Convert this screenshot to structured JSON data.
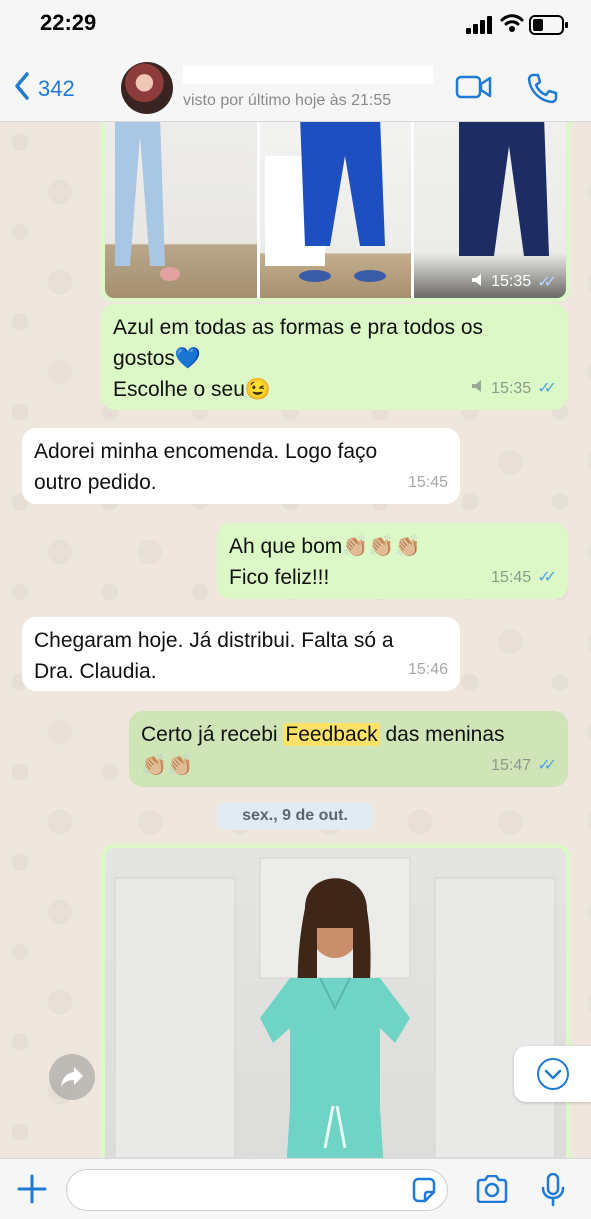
{
  "status_bar": {
    "time": "22:29"
  },
  "header": {
    "back_count": "342",
    "contact_status": "visto por último hoje às 21:55"
  },
  "messages": [
    {
      "id": "img1",
      "type": "image",
      "direction": "out",
      "time": "15:35"
    },
    {
      "id": "m1",
      "direction": "out",
      "lines": [
        "Azul em todas as formas e pra todos os",
        "gostos💙",
        "Escolhe o seu😉"
      ],
      "time": "15:35"
    },
    {
      "id": "m2",
      "direction": "in",
      "lines": [
        "Adorei minha encomenda. Logo faço",
        "outro pedido."
      ],
      "time": "15:45"
    },
    {
      "id": "m3",
      "direction": "out",
      "lines": [
        "Ah que bom👏🏼👏🏼👏🏼",
        "Fico feliz!!!"
      ],
      "time": "15:45"
    },
    {
      "id": "m4",
      "direction": "in",
      "lines": [
        "Chegaram hoje. Já distribui. Falta só a",
        "Dra. Claudia."
      ],
      "time": "15:46"
    },
    {
      "id": "m5",
      "direction": "out",
      "line1_before": "Certo já recebi ",
      "line1_highlight": "Feedback",
      "line1_after": " das meninas",
      "line2": "👏🏼👏🏼",
      "time": "15:47"
    },
    {
      "id": "img2",
      "type": "image",
      "direction": "out"
    }
  ],
  "date_separator": "sex., 9 de out.",
  "input": {
    "value": ""
  },
  "colors": {
    "accent": "#1f7bd6",
    "outgoing_bubble": "#dcf8c6",
    "incoming_bubble": "#ffffff",
    "highlight": "#fde26a",
    "read_ticks": "#4fa6e8"
  }
}
